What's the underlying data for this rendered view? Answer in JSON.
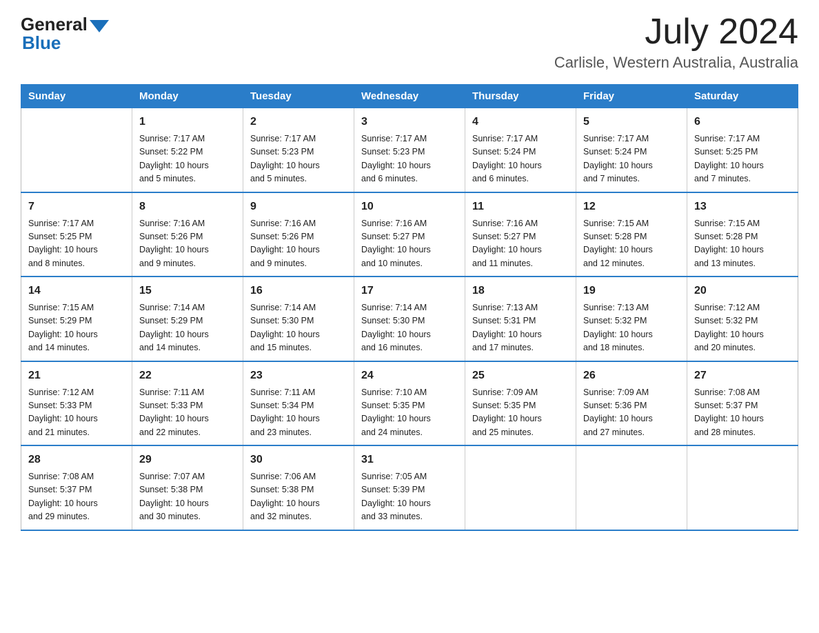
{
  "header": {
    "logo_general": "General",
    "logo_blue": "Blue",
    "month_year": "July 2024",
    "location": "Carlisle, Western Australia, Australia"
  },
  "weekdays": [
    "Sunday",
    "Monday",
    "Tuesday",
    "Wednesday",
    "Thursday",
    "Friday",
    "Saturday"
  ],
  "weeks": [
    [
      {
        "day": "",
        "info": ""
      },
      {
        "day": "1",
        "info": "Sunrise: 7:17 AM\nSunset: 5:22 PM\nDaylight: 10 hours\nand 5 minutes."
      },
      {
        "day": "2",
        "info": "Sunrise: 7:17 AM\nSunset: 5:23 PM\nDaylight: 10 hours\nand 5 minutes."
      },
      {
        "day": "3",
        "info": "Sunrise: 7:17 AM\nSunset: 5:23 PM\nDaylight: 10 hours\nand 6 minutes."
      },
      {
        "day": "4",
        "info": "Sunrise: 7:17 AM\nSunset: 5:24 PM\nDaylight: 10 hours\nand 6 minutes."
      },
      {
        "day": "5",
        "info": "Sunrise: 7:17 AM\nSunset: 5:24 PM\nDaylight: 10 hours\nand 7 minutes."
      },
      {
        "day": "6",
        "info": "Sunrise: 7:17 AM\nSunset: 5:25 PM\nDaylight: 10 hours\nand 7 minutes."
      }
    ],
    [
      {
        "day": "7",
        "info": "Sunrise: 7:17 AM\nSunset: 5:25 PM\nDaylight: 10 hours\nand 8 minutes."
      },
      {
        "day": "8",
        "info": "Sunrise: 7:16 AM\nSunset: 5:26 PM\nDaylight: 10 hours\nand 9 minutes."
      },
      {
        "day": "9",
        "info": "Sunrise: 7:16 AM\nSunset: 5:26 PM\nDaylight: 10 hours\nand 9 minutes."
      },
      {
        "day": "10",
        "info": "Sunrise: 7:16 AM\nSunset: 5:27 PM\nDaylight: 10 hours\nand 10 minutes."
      },
      {
        "day": "11",
        "info": "Sunrise: 7:16 AM\nSunset: 5:27 PM\nDaylight: 10 hours\nand 11 minutes."
      },
      {
        "day": "12",
        "info": "Sunrise: 7:15 AM\nSunset: 5:28 PM\nDaylight: 10 hours\nand 12 minutes."
      },
      {
        "day": "13",
        "info": "Sunrise: 7:15 AM\nSunset: 5:28 PM\nDaylight: 10 hours\nand 13 minutes."
      }
    ],
    [
      {
        "day": "14",
        "info": "Sunrise: 7:15 AM\nSunset: 5:29 PM\nDaylight: 10 hours\nand 14 minutes."
      },
      {
        "day": "15",
        "info": "Sunrise: 7:14 AM\nSunset: 5:29 PM\nDaylight: 10 hours\nand 14 minutes."
      },
      {
        "day": "16",
        "info": "Sunrise: 7:14 AM\nSunset: 5:30 PM\nDaylight: 10 hours\nand 15 minutes."
      },
      {
        "day": "17",
        "info": "Sunrise: 7:14 AM\nSunset: 5:30 PM\nDaylight: 10 hours\nand 16 minutes."
      },
      {
        "day": "18",
        "info": "Sunrise: 7:13 AM\nSunset: 5:31 PM\nDaylight: 10 hours\nand 17 minutes."
      },
      {
        "day": "19",
        "info": "Sunrise: 7:13 AM\nSunset: 5:32 PM\nDaylight: 10 hours\nand 18 minutes."
      },
      {
        "day": "20",
        "info": "Sunrise: 7:12 AM\nSunset: 5:32 PM\nDaylight: 10 hours\nand 20 minutes."
      }
    ],
    [
      {
        "day": "21",
        "info": "Sunrise: 7:12 AM\nSunset: 5:33 PM\nDaylight: 10 hours\nand 21 minutes."
      },
      {
        "day": "22",
        "info": "Sunrise: 7:11 AM\nSunset: 5:33 PM\nDaylight: 10 hours\nand 22 minutes."
      },
      {
        "day": "23",
        "info": "Sunrise: 7:11 AM\nSunset: 5:34 PM\nDaylight: 10 hours\nand 23 minutes."
      },
      {
        "day": "24",
        "info": "Sunrise: 7:10 AM\nSunset: 5:35 PM\nDaylight: 10 hours\nand 24 minutes."
      },
      {
        "day": "25",
        "info": "Sunrise: 7:09 AM\nSunset: 5:35 PM\nDaylight: 10 hours\nand 25 minutes."
      },
      {
        "day": "26",
        "info": "Sunrise: 7:09 AM\nSunset: 5:36 PM\nDaylight: 10 hours\nand 27 minutes."
      },
      {
        "day": "27",
        "info": "Sunrise: 7:08 AM\nSunset: 5:37 PM\nDaylight: 10 hours\nand 28 minutes."
      }
    ],
    [
      {
        "day": "28",
        "info": "Sunrise: 7:08 AM\nSunset: 5:37 PM\nDaylight: 10 hours\nand 29 minutes."
      },
      {
        "day": "29",
        "info": "Sunrise: 7:07 AM\nSunset: 5:38 PM\nDaylight: 10 hours\nand 30 minutes."
      },
      {
        "day": "30",
        "info": "Sunrise: 7:06 AM\nSunset: 5:38 PM\nDaylight: 10 hours\nand 32 minutes."
      },
      {
        "day": "31",
        "info": "Sunrise: 7:05 AM\nSunset: 5:39 PM\nDaylight: 10 hours\nand 33 minutes."
      },
      {
        "day": "",
        "info": ""
      },
      {
        "day": "",
        "info": ""
      },
      {
        "day": "",
        "info": ""
      }
    ]
  ]
}
